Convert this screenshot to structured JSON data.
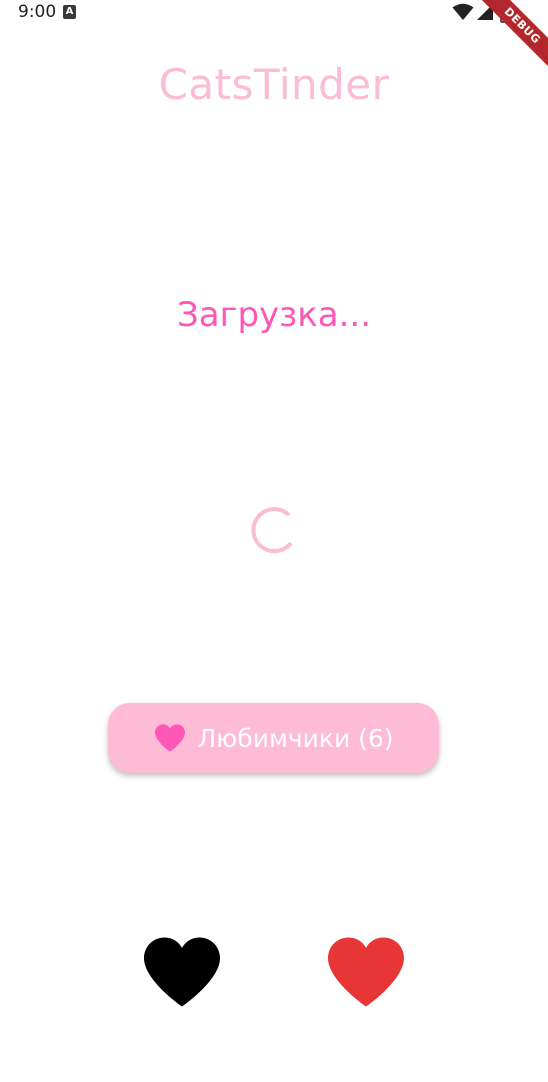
{
  "status_bar": {
    "time": "9:00",
    "notification_icon": "a-icon",
    "icons": [
      "wifi-icon",
      "cell-signal-icon",
      "battery-icon"
    ]
  },
  "debug_banner": {
    "label": "DEBUG",
    "color": "#b3262c"
  },
  "app": {
    "title": "CatsTinder",
    "loading_text": "Загрузка...",
    "favorites_button_label": "Любимчики (6)",
    "favorites_icon": "heart-icon",
    "dislike_icon": "heart-icon",
    "like_icon": "heart-icon"
  },
  "colors": {
    "title": "#fbbcd6",
    "loading_text": "#ff57b6",
    "spinner": "#fbbcd6",
    "favorites_button_bg": "#fdbbd6",
    "favorites_heart": "#ff57b6",
    "dislike_heart": "#000000",
    "like_heart": "#e83535"
  }
}
